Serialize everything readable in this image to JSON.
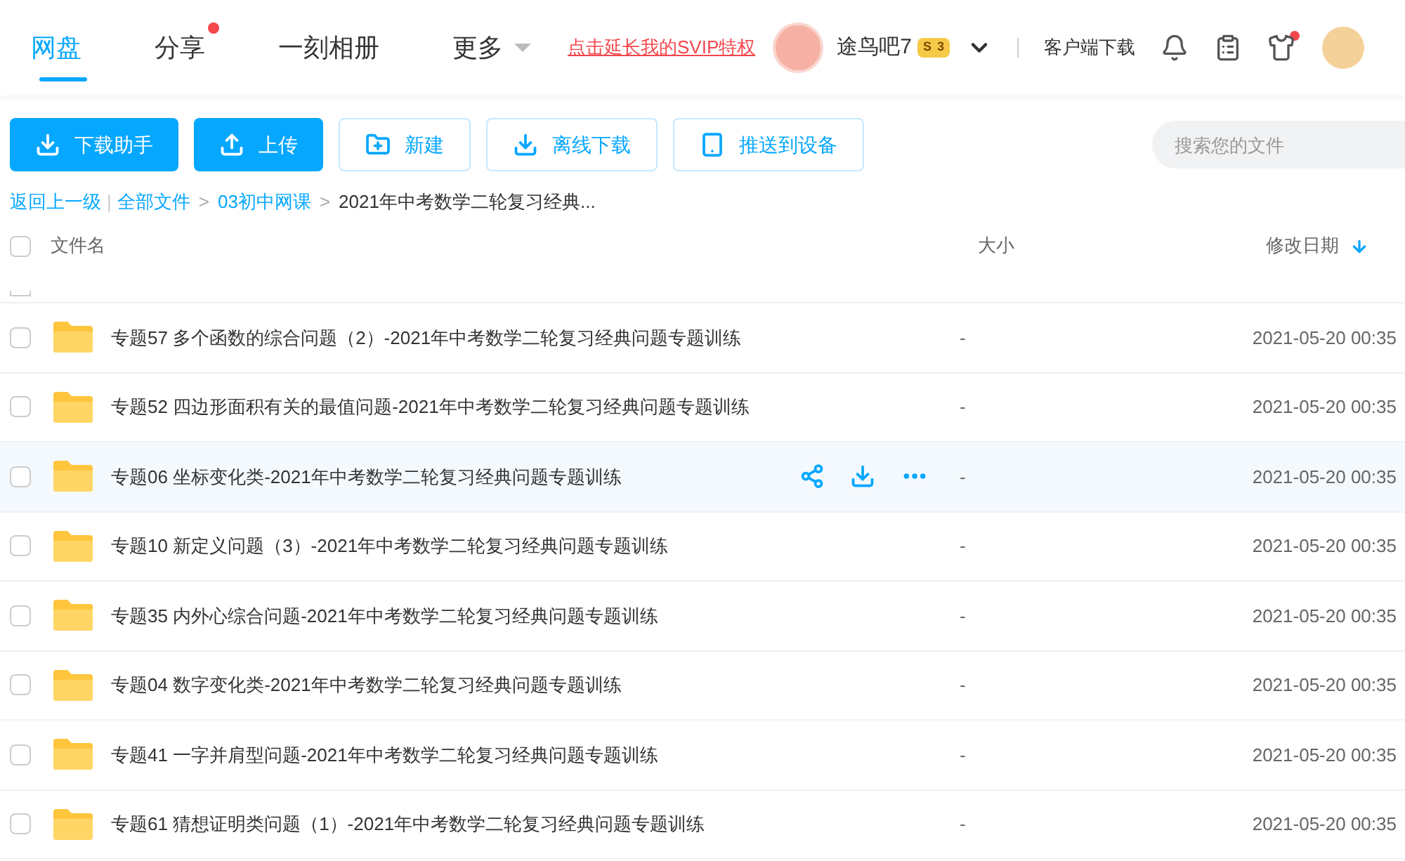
{
  "nav": {
    "tabs": [
      {
        "label": "网盘",
        "selected": true,
        "dot": false
      },
      {
        "label": "分享",
        "selected": false,
        "dot": true
      },
      {
        "label": "一刻相册",
        "selected": false,
        "dot": false
      },
      {
        "label": "更多",
        "selected": false,
        "dot": false
      }
    ],
    "promo": "点击延长我的SVIP特权",
    "user": "途鸟吧7",
    "level_symbol": "S",
    "level": "3",
    "client_download": "客户端下载"
  },
  "toolbar": {
    "buttons": [
      {
        "label": "下载助手",
        "kind": "primary"
      },
      {
        "label": "上传",
        "kind": "primary"
      },
      {
        "label": "新建",
        "kind": "outline"
      },
      {
        "label": "离线下载",
        "kind": "outline"
      },
      {
        "label": "推送到设备",
        "kind": "outline"
      }
    ],
    "search": {
      "placeholder": "搜索您的文件"
    }
  },
  "breadcrumb": {
    "back": "返回上一级",
    "divider": "|",
    "items": [
      {
        "label": "全部文件",
        "link": true
      },
      {
        "separator": ">",
        "label": "03初中网课",
        "link": true
      },
      {
        "separator": ">",
        "label": "2021年中考数学二轮复习经典...",
        "link": false
      }
    ]
  },
  "select_all": {
    "checked": false
  },
  "table": {
    "columns": [
      "文件名",
      "大小",
      "修改日期"
    ],
    "rows": [
      {
        "name": "专题57 多个函数的综合问题（2）-2021年中考数学二轮复习经典问题专题训练",
        "size": "-",
        "date": "2021-05-20 00:35",
        "hovered": false
      },
      {
        "name": "专题52 四边形面积有关的最值问题-2021年中考数学二轮复习经典问题专题训练",
        "size": "-",
        "date": "2021-05-20 00:35",
        "hovered": false
      },
      {
        "name": "专题06 坐标变化类-2021年中考数学二轮复习经典问题专题训练",
        "size": "-",
        "date": "2021-05-20 00:35",
        "hovered": true
      },
      {
        "name": "专题10 新定义问题（3）-2021年中考数学二轮复习经典问题专题训练",
        "size": "-",
        "date": "2021-05-20 00:35",
        "hovered": false
      },
      {
        "name": "专题35 内外心综合问题-2021年中考数学二轮复习经典问题专题训练",
        "size": "-",
        "date": "2021-05-20 00:35",
        "hovered": false
      },
      {
        "name": "专题04 数字变化类-2021年中考数学二轮复习经典问题专题训练",
        "size": "-",
        "date": "2021-05-20 00:35",
        "hovered": false
      },
      {
        "name": "专题41 一字并肩型问题-2021年中考数学二轮复习经典问题专题训练",
        "size": "-",
        "date": "2021-05-20 00:35",
        "hovered": false
      },
      {
        "name": "专题61 猜想证明类问题（1）-2021年中考数学二轮复习经典问题专题训练",
        "size": "-",
        "date": "2021-05-20 00:35",
        "hovered": false
      }
    ]
  }
}
